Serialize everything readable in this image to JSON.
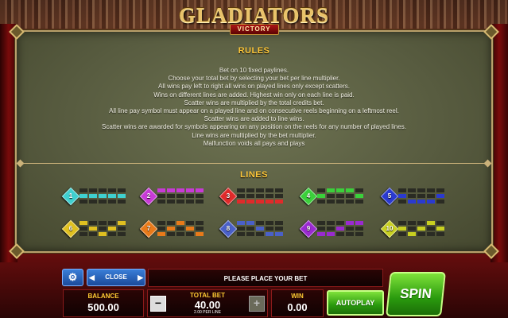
{
  "logo": {
    "title": "GLADIATORS",
    "subtitle": "VICTORY"
  },
  "rules": {
    "heading": "RULES",
    "lines": [
      "Bet on 10 fixed paylines.",
      "Choose your total bet by selecting your bet per line multiplier.",
      "All wins pay left to right all wins on played lines only except scatters.",
      "Wins on different lines are added. Highest win only on each line is paid.",
      "Scatter wins are multiplied by the total credits bet.",
      "All line pay symbol must appear on a played line and on consecutive reels beginning on a leftmost reel.",
      "Scatter wins are added to line wins.",
      "Scatter wins are awarded for symbols appearing on any position on the reels for any number of played lines.",
      "Line wins are multiplied by the bet multiplier.",
      "Malfunction voids all pays and plays"
    ]
  },
  "lines": {
    "heading": "LINES",
    "items": [
      {
        "number": "1",
        "color": "#3fd0d0",
        "rows": [
          1,
          1,
          1,
          1,
          1
        ]
      },
      {
        "number": "2",
        "color": "#c83ad6",
        "rows": [
          0,
          0,
          0,
          0,
          0
        ]
      },
      {
        "number": "3",
        "color": "#e02a2a",
        "rows": [
          2,
          2,
          2,
          2,
          2
        ]
      },
      {
        "number": "4",
        "color": "#3bd03b",
        "rows": [
          1,
          0,
          0,
          0,
          1
        ]
      },
      {
        "number": "5",
        "color": "#2a3ad0",
        "rows": [
          1,
          2,
          2,
          2,
          1
        ]
      },
      {
        "number": "6",
        "color": "#e0c020",
        "rows": [
          0,
          1,
          2,
          1,
          0
        ]
      },
      {
        "number": "7",
        "color": "#e87a1a",
        "rows": [
          2,
          1,
          0,
          1,
          2
        ]
      },
      {
        "number": "8",
        "color": "#4a60c8",
        "rows": [
          0,
          0,
          1,
          2,
          2
        ]
      },
      {
        "number": "9",
        "color": "#9a2ad0",
        "rows": [
          2,
          2,
          1,
          0,
          0
        ]
      },
      {
        "number": "10",
        "color": "#c8d020",
        "rows": [
          1,
          2,
          1,
          0,
          1
        ]
      }
    ]
  },
  "controls": {
    "close_label": "CLOSE",
    "message": "PLEASE PLACE YOUR BET",
    "balance_label": "BALANCE",
    "balance_value": "500.00",
    "total_bet_label": "TOTAL BET",
    "total_bet_value": "40.00",
    "per_line_text": "2.00 PER LINE",
    "win_label": "WIN",
    "win_value": "0.00",
    "autoplay_label": "AUTOPLAY",
    "spin_label": "SPIN",
    "minus": "−",
    "plus": "+",
    "settings_icon": "gear-icon",
    "prev_icon": "chevron-left-icon",
    "next_icon": "chevron-right-icon"
  }
}
